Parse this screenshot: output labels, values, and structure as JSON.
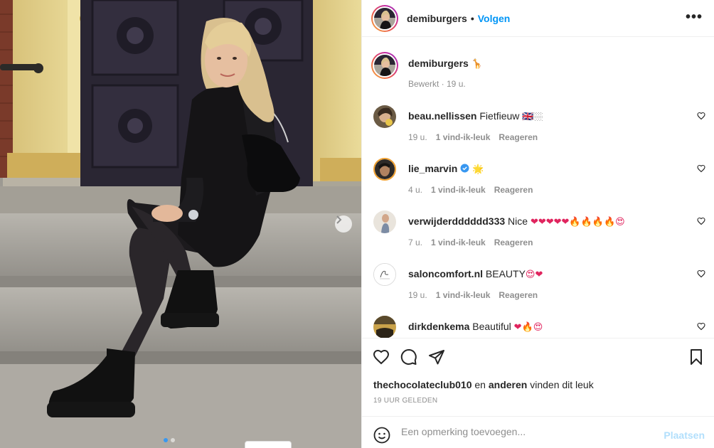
{
  "post": {
    "username": "demiburgers",
    "follow_label": "Volgen",
    "more_label": "•••",
    "caption_emoji": "🦒",
    "caption_meta": "Bewerkt · 19 u.",
    "header_separator": "•"
  },
  "comments": [
    {
      "user": "beau.nellissen",
      "text": "Fietfieuw",
      "emoji": "🇬🇧🏼",
      "time": "19 u.",
      "likes": "1 vind-ik-leuk",
      "reply": "Reageren"
    },
    {
      "user": "lie_marvin",
      "text": "",
      "emoji": "🌟",
      "time": "4 u.",
      "likes": "1 vind-ik-leuk",
      "reply": "Reageren",
      "verified": true
    },
    {
      "user": "verwijderdddddd333",
      "text": "Nice",
      "emoji": "❤❤❤❤❤🔥🔥🔥🔥😍",
      "time": "7 u.",
      "likes": "1 vind-ik-leuk",
      "reply": "Reageren"
    },
    {
      "user": "saloncomfort.nl",
      "text": "BEAUTY",
      "emoji": "😍❤",
      "time": "19 u.",
      "likes": "1 vind-ik-leuk",
      "reply": "Reageren"
    },
    {
      "user": "dirkdenkema",
      "text": "Beautiful",
      "emoji": "❤🔥😍",
      "time": "",
      "likes": "",
      "reply": ""
    }
  ],
  "likes": {
    "user": "thechocolateclub010",
    "connector": "en",
    "others": "anderen",
    "suffix": "vinden dit leuk"
  },
  "date_label": "19 UUR GELEDEN",
  "add_comment": {
    "placeholder": "Een opmerking toevoegen...",
    "post_label": "Plaatsen"
  },
  "icons": {
    "like": "heart-icon",
    "comment": "comment-bubble-icon",
    "share": "paper-plane-icon",
    "save": "bookmark-icon",
    "emoji": "smile-icon",
    "next": "chevron-right-icon",
    "more": "more-dots-icon",
    "verified": "verified-badge-icon"
  },
  "colors": {
    "accent": "#0095f6",
    "post_disabled": "#b2dffc",
    "meta_gray": "#8e8e8e",
    "text": "#262626",
    "border": "#efefef"
  },
  "carousel": {
    "current": 1,
    "total": 2
  }
}
